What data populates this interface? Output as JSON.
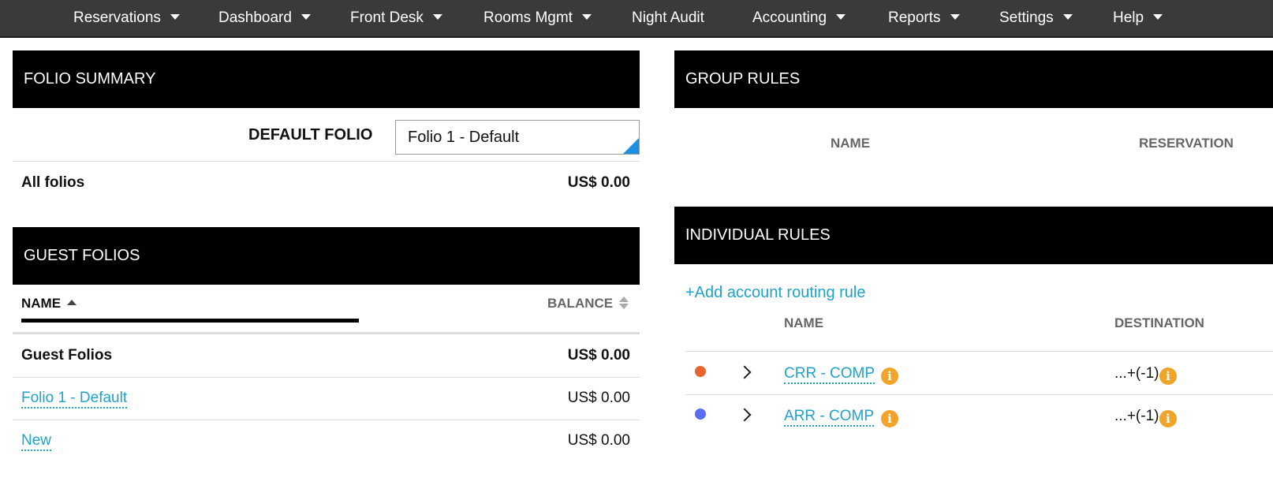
{
  "nav": {
    "items": [
      {
        "label": "Reservations",
        "has_menu": true
      },
      {
        "label": "Dashboard",
        "has_menu": true
      },
      {
        "label": "Front Desk",
        "has_menu": true
      },
      {
        "label": "Rooms Mgmt",
        "has_menu": true
      },
      {
        "label": "Night Audit",
        "has_menu": false
      },
      {
        "label": "Accounting",
        "has_menu": true
      },
      {
        "label": "Reports",
        "has_menu": true
      },
      {
        "label": "Settings",
        "has_menu": true
      },
      {
        "label": "Help",
        "has_menu": true
      }
    ]
  },
  "folio_summary": {
    "title": "FOLIO SUMMARY",
    "default_folio_label": "DEFAULT FOLIO",
    "default_folio_value": "Folio 1 - Default",
    "all_folios_label": "All folios",
    "all_folios_amount": "US$ 0.00"
  },
  "guest_folios": {
    "title": "GUEST FOLIOS",
    "col_name": "NAME",
    "col_balance": "BALANCE",
    "group_label": "Guest Folios",
    "group_amount": "US$ 0.00",
    "rows": [
      {
        "name": "Folio 1 - Default",
        "amount": "US$ 0.00"
      },
      {
        "name": "New",
        "amount": "US$ 0.00"
      }
    ]
  },
  "group_rules": {
    "title": "GROUP RULES",
    "col_name": "NAME",
    "col_reservation": "RESERVATION"
  },
  "individual_rules": {
    "title": "INDIVIDUAL RULES",
    "add_link": "+Add account routing rule",
    "col_name": "NAME",
    "col_destination": "DESTINATION",
    "rows": [
      {
        "name": "CRR - COMP",
        "destination": "...+(-1)",
        "dot_color": "#e8642c"
      },
      {
        "name": "ARR - COMP",
        "destination": "...+(-1)",
        "dot_color": "#5a6cf0"
      }
    ]
  },
  "colors": {
    "nav_bg": "#3a3a3a",
    "header_bg": "#000000",
    "link": "#1fa3c9",
    "info_badge": "#f0a52a",
    "select_corner": "#1e8fe0"
  }
}
